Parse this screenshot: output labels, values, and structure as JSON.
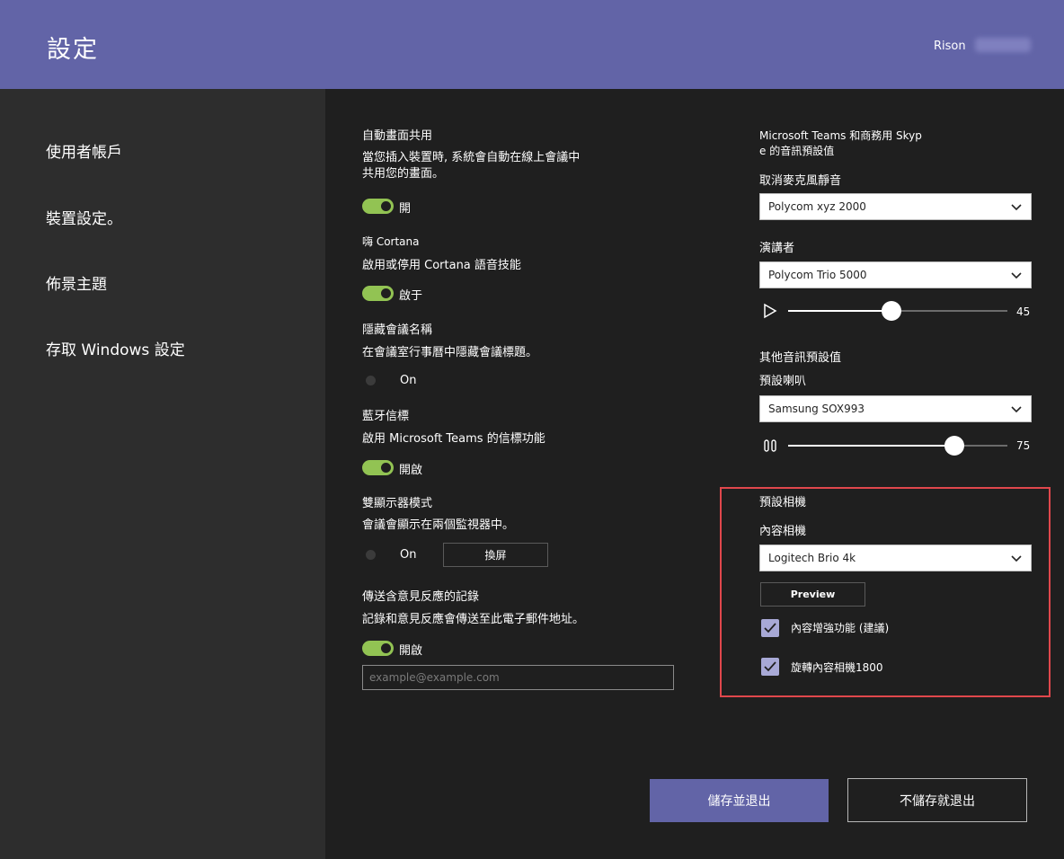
{
  "header": {
    "title": "設定",
    "user_name": "Rison"
  },
  "sidebar": {
    "items": [
      {
        "label": "使用者帳戶"
      },
      {
        "label": "裝置設定。"
      },
      {
        "label": "佈景主題"
      },
      {
        "label": "存取 Windows 設定"
      }
    ]
  },
  "left_settings": {
    "auto_share": {
      "title": "自動畫面共用",
      "desc_line1": "當您插入裝置時, 系統會自動在線上會議中",
      "desc_line2": "共用您的畫面。",
      "toggle_label": "開",
      "on": true
    },
    "cortana": {
      "title": "嗨 Cortana",
      "desc": "啟用或停用 Cortana 語音技能",
      "toggle_label": "啟于",
      "on": true
    },
    "hide_meeting_name": {
      "title": "隱藏會議名稱",
      "desc": "在會議室行事曆中隱藏會議標題。",
      "toggle_label": "On",
      "on": false
    },
    "bluetooth": {
      "title": "藍牙信標",
      "desc": "啟用 Microsoft Teams 的信標功能",
      "toggle_label": "開啟",
      "on": true
    },
    "dual_display": {
      "title": "雙顯示器模式",
      "desc": "會議會顯示在兩個監視器中。",
      "toggle_label": "On",
      "on": false,
      "swap_button": "換屏"
    },
    "feedback": {
      "title": "傳送含意見反應的記錄",
      "desc": "記錄和意見反應會傳送至此電子郵件地址。",
      "toggle_label": "開啟",
      "on": true,
      "email_placeholder": "example@example.com"
    }
  },
  "right_settings": {
    "audio_heading_line1": "Microsoft Teams 和商務用 Skyp",
    "audio_heading_line2": "e 的音訊預設值",
    "mic_label": "取消麥克風靜音",
    "mic_value": "Polycom xyz 2000",
    "speaker_label": "演講者",
    "speaker_value": "Polycom Trio 5000",
    "speaker_volume": "45",
    "speaker_volume_fraction": 0.47,
    "other_audio_label": "其他音訊預設值",
    "default_speaker_label": "預設喇叭",
    "default_speaker_value": "Samsung SOX993",
    "default_volume": "75",
    "default_volume_fraction": 0.76,
    "camera_heading": "預設相機",
    "content_camera_label": "內容相機",
    "content_camera_value": "Logitech Brio 4k",
    "preview_button": "Preview",
    "enhance_label": "內容增強功能 (建議)",
    "enhance_checked": true,
    "rotate_label": "旋轉內容相機1800",
    "rotate_checked": true
  },
  "footer": {
    "save_exit": "儲存並退出",
    "exit_no_save": "不儲存就退出"
  },
  "colors": {
    "header": "#6264a7",
    "toggle_on": "#92c353",
    "highlight": "#e0474c",
    "checkbox": "#a8a9d6"
  }
}
